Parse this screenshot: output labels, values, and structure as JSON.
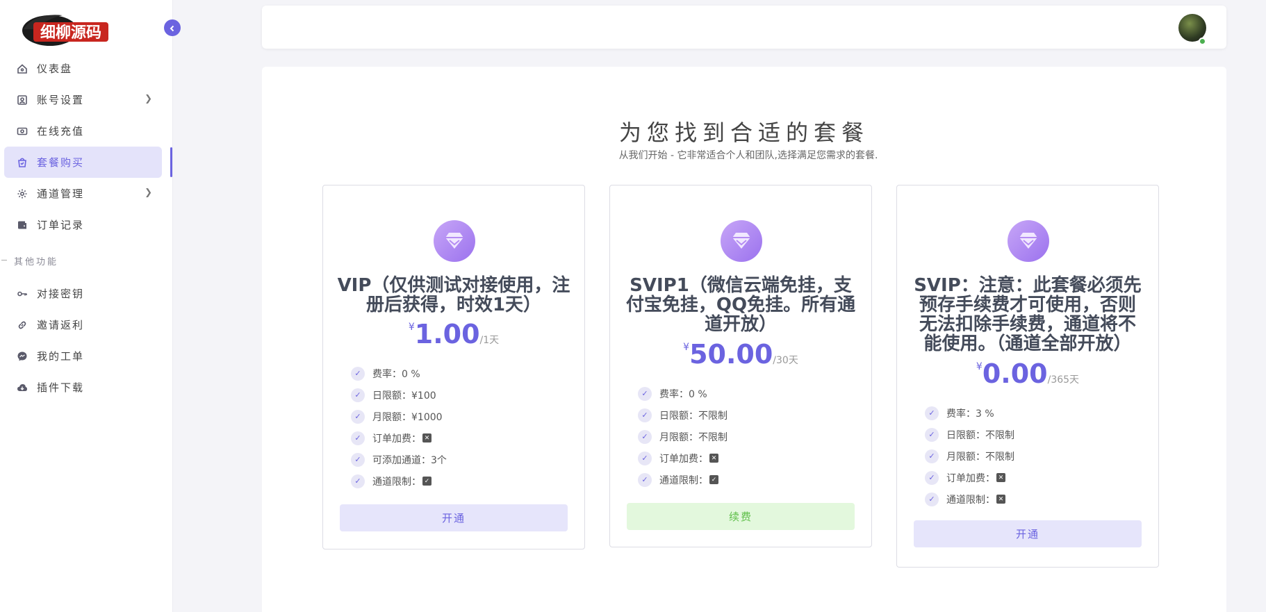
{
  "brand": {
    "logo_text": "细柳源码"
  },
  "sidebar": {
    "items": [
      {
        "label": "仪表盘",
        "icon": "home-icon"
      },
      {
        "label": "账号设置",
        "icon": "user-card-icon",
        "has_sub": true
      },
      {
        "label": "在线充值",
        "icon": "money-icon"
      },
      {
        "label": "套餐购买",
        "icon": "shopping-bag-icon",
        "active": true
      },
      {
        "label": "通道管理",
        "icon": "gear-icon",
        "has_sub": true
      },
      {
        "label": "订单记录",
        "icon": "wallet-icon"
      }
    ],
    "section_title": "其他功能",
    "other_items": [
      {
        "label": "对接密钥",
        "icon": "key-icon"
      },
      {
        "label": "邀请返利",
        "icon": "link-icon"
      },
      {
        "label": "我的工单",
        "icon": "messenger-icon"
      },
      {
        "label": "插件下载",
        "icon": "cloud-download-icon"
      }
    ]
  },
  "main": {
    "title": "为您找到合适的套餐",
    "subtitle": "从我们开始 - 它非常适合个人和团队,选择满足您需求的套餐."
  },
  "plans": [
    {
      "name": "VIP（仅供测试对接使用，注册后获得，时效1天）",
      "currency": "¥",
      "price": "1.00",
      "period": "/1天",
      "features": [
        {
          "label": "费率：0 %"
        },
        {
          "label": "日限额：¥100"
        },
        {
          "label": "月限额：¥1000"
        },
        {
          "label": "订单加费：",
          "mark": "✕"
        },
        {
          "label": "可添加通道：3个"
        },
        {
          "label": "通道限制：",
          "mark": "✓"
        }
      ],
      "button": "开通",
      "button_style": "open"
    },
    {
      "name": "SVIP1（微信云端免挂，支付宝免挂，QQ免挂。所有通道开放）",
      "currency": "¥",
      "price": "50.00",
      "period": "/30天",
      "features": [
        {
          "label": "费率：0 %"
        },
        {
          "label": "日限额：不限制"
        },
        {
          "label": "月限额：不限制"
        },
        {
          "label": "订单加费：",
          "mark": "✕"
        },
        {
          "label": "通道限制：",
          "mark": "✓"
        }
      ],
      "button": "续费",
      "button_style": "renew"
    },
    {
      "name": "SVIP：注意：此套餐必须先预存手续费才可使用，否则无法扣除手续费，通道将不能使用。（通道全部开放）",
      "currency": "¥",
      "price": "0.00",
      "period": "/365天",
      "features": [
        {
          "label": "费率：3 %"
        },
        {
          "label": "日限额：不限制"
        },
        {
          "label": "月限额：不限制"
        },
        {
          "label": "订单加费：",
          "mark": "✕"
        },
        {
          "label": "通道限制：",
          "mark": "✕"
        }
      ],
      "button": "开通",
      "button_style": "open"
    }
  ],
  "colors": {
    "accent": "#6b63e0",
    "renew": "#5fbf4a"
  }
}
